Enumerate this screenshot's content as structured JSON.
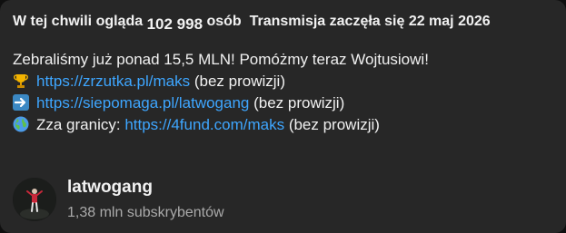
{
  "header": {
    "watching_prefix": "W tej chwili ogląda",
    "watching_count": "102 998",
    "watching_suffix": "osób",
    "stream_started": "Transmisja zaczęła się 22 maj 2026"
  },
  "description": {
    "headline": "Zebraliśmy już ponad 15,5 MLN! Pomóżmy teraz Wojtusiowi!",
    "links": [
      {
        "icon": "trophy-icon",
        "prefix": "",
        "url": "https://zrzutka.pl/maks",
        "note": "(bez prowizji)"
      },
      {
        "icon": "right-arrow-icon",
        "prefix": "",
        "url": "https://siepomaga.pl/latwogang",
        "note": "(bez prowizji)"
      },
      {
        "icon": "globe-icon",
        "prefix": "Zza granicy:",
        "url": "https://4fund.com/maks",
        "note": "(bez prowizji)"
      }
    ]
  },
  "channel": {
    "name": "latwogang",
    "subscribers": "1,38 mln subskrybentów"
  },
  "colors": {
    "background": "#272727",
    "link": "#3ea6ff",
    "text": "#f1f1f1",
    "secondary_text": "#aaaaaa"
  }
}
